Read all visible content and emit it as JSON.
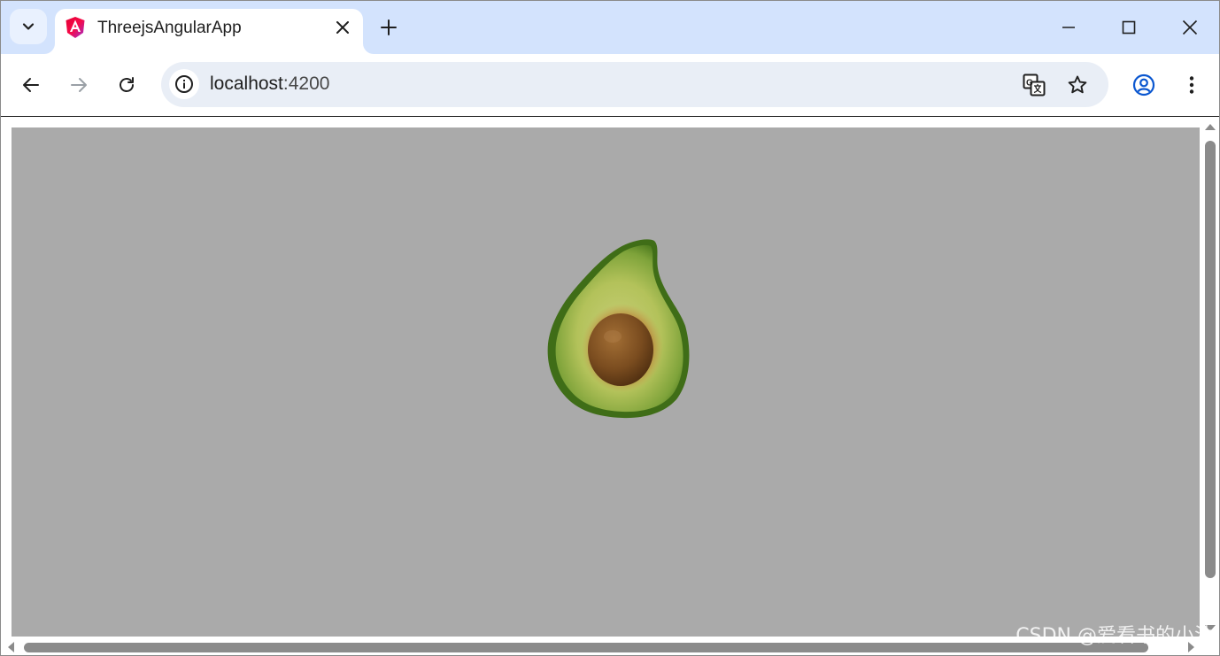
{
  "tab": {
    "title": "ThreejsAngularApp"
  },
  "address_bar": {
    "host": "localhost",
    "port": ":4200"
  },
  "page": {
    "background_color": "#aaaaaa",
    "model": "avocado"
  },
  "watermark": "CSDN @爱看书的小沐",
  "colors": {
    "tab_strip": "#d3e3fd",
    "omnibox": "#e9eef6",
    "profile_accent": "#0b57d0"
  }
}
